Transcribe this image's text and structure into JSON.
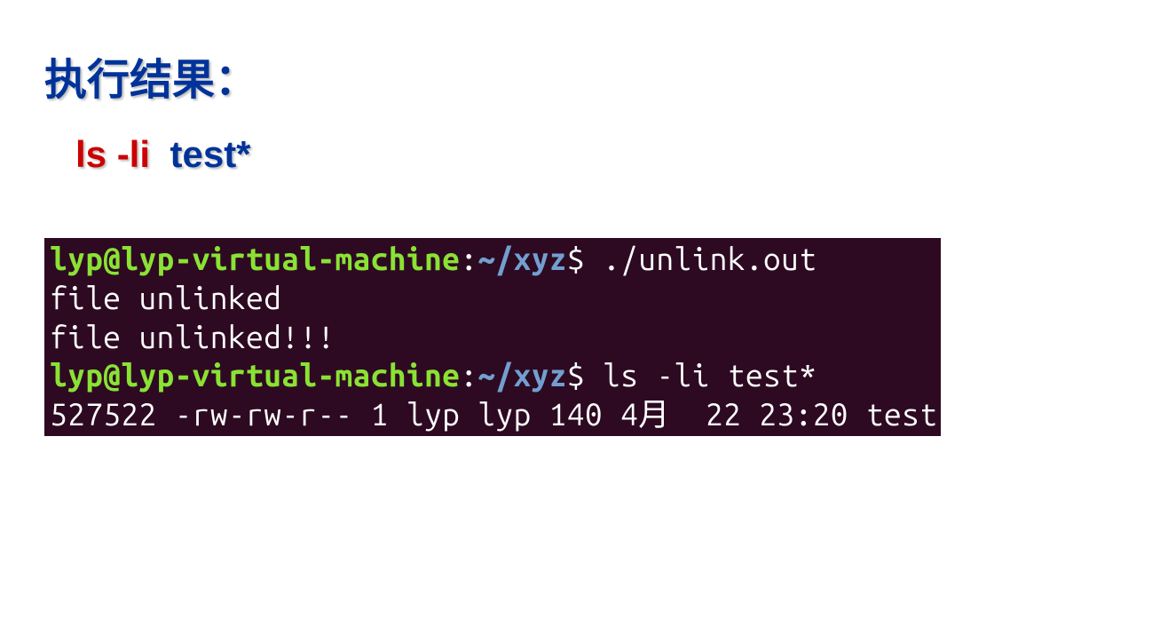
{
  "heading": "执行结果：",
  "command": {
    "red_part": "ls  -li",
    "blue_part": "test*"
  },
  "terminal": {
    "line1": {
      "prompt_user": "lyp@lyp-virtual-machine",
      "prompt_sep": ":",
      "prompt_path": "~/xyz",
      "prompt_dollar": "$ ",
      "command": "./unlink.out"
    },
    "line2": "file unlinked",
    "line3": "file unlinked!!!",
    "line4": {
      "prompt_user": "lyp@lyp-virtual-machine",
      "prompt_sep": ":",
      "prompt_path": "~/xyz",
      "prompt_dollar": "$ ",
      "command": "ls -li test*"
    },
    "line5": "527522 -rw-rw-r-- 1 lyp lyp 140 4月  22 23:20 test"
  }
}
